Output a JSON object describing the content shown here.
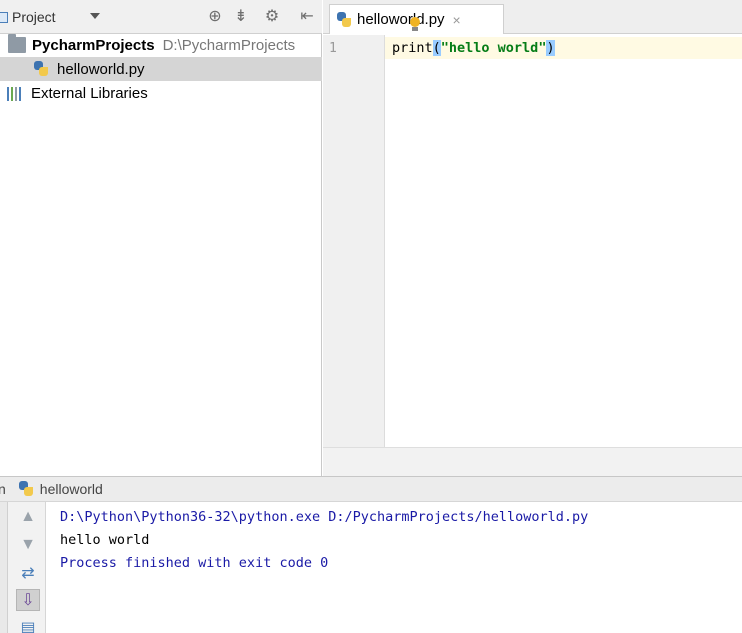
{
  "project_panel": {
    "title": "Project",
    "tree": {
      "root_name": "PycharmProjects",
      "root_path": "D:\\PycharmProjects",
      "file_name": "helloworld.py",
      "libraries": "External Libraries"
    },
    "icons": [
      "locate-icon",
      "collapse-icon",
      "gear-icon",
      "hide-icon"
    ]
  },
  "editor": {
    "tab_label": "helloworld.py",
    "tab_close": "×",
    "line_number": "1",
    "code": {
      "fn": "print",
      "open_paren": "(",
      "string": "\"hello world\"",
      "close_paren": ")"
    }
  },
  "run_panel": {
    "label": "n",
    "config_name": "helloworld",
    "console": {
      "command": "D:\\Python\\Python36-32\\python.exe D:/PycharmProjects/helloworld.py",
      "output": "hello world",
      "blank": "",
      "exit": "Process finished with exit code 0"
    }
  },
  "colors": {
    "string_green": "#067d17",
    "paren_highlight": "#99ccff",
    "console_blue": "#1a1aa6",
    "selection_gray": "#d5d5d5"
  }
}
